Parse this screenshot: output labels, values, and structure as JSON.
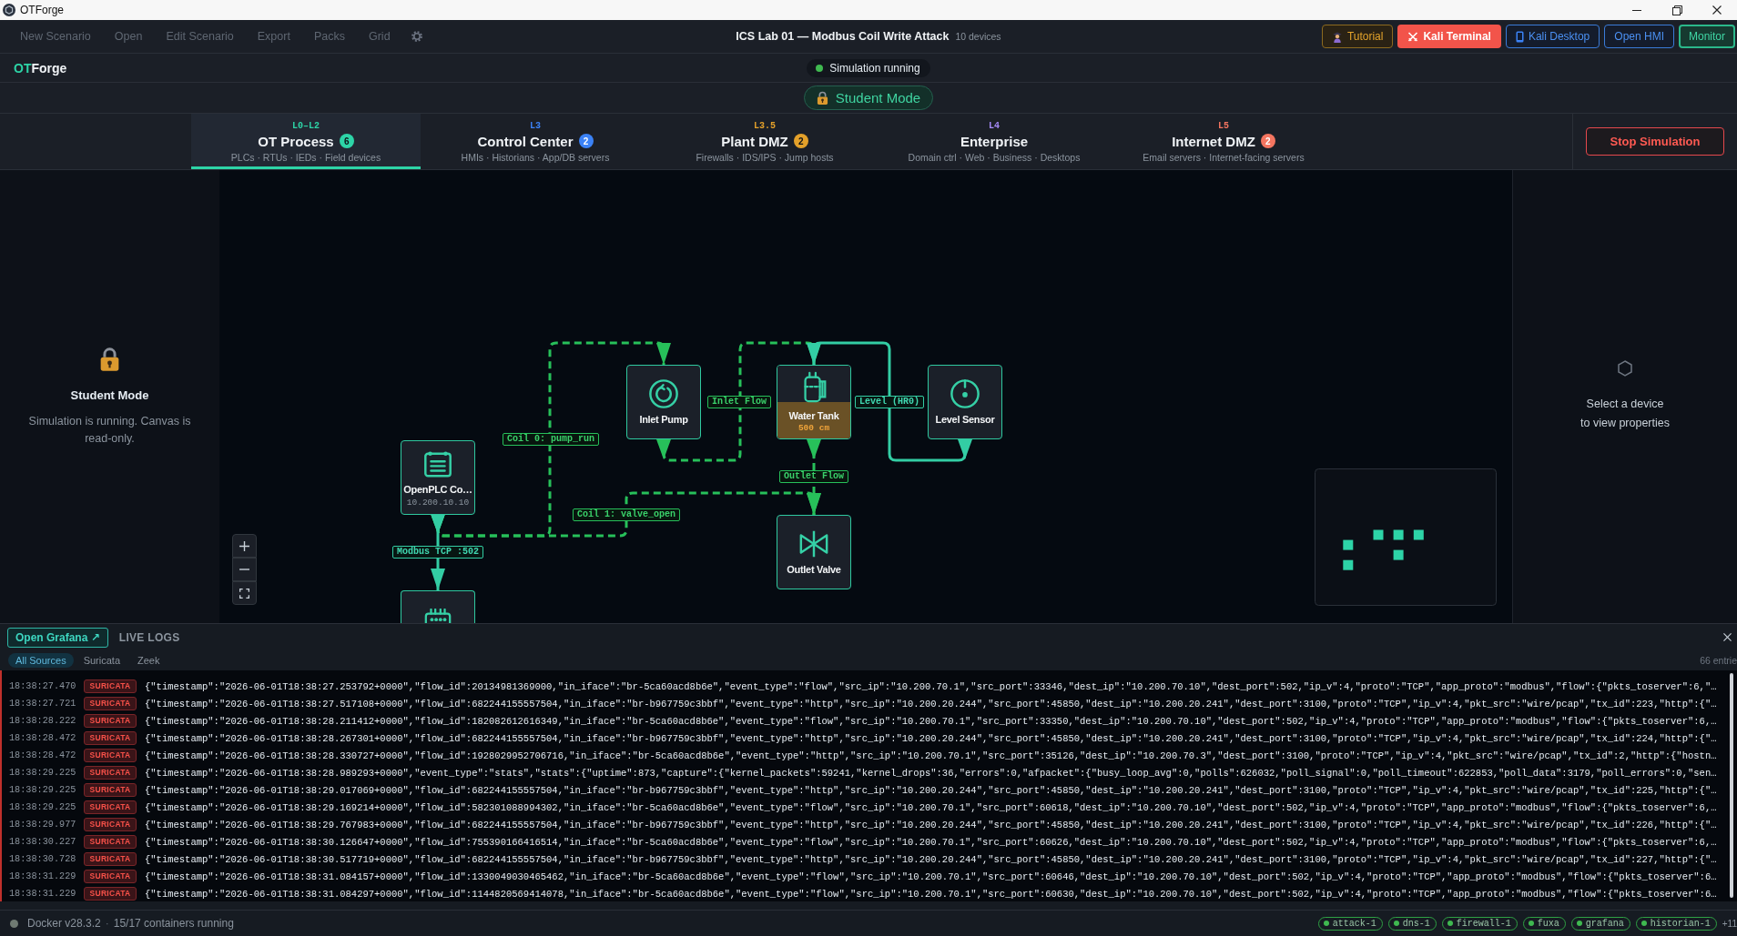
{
  "window": {
    "title": "OTForge"
  },
  "menu": [
    {
      "label": "New Scenario",
      "disabled": true
    },
    {
      "label": "Open",
      "disabled": true
    },
    {
      "label": "Edit Scenario",
      "disabled": true
    },
    {
      "label": "Export",
      "disabled": true
    },
    {
      "label": "Packs",
      "disabled": true
    },
    {
      "label": "Grid",
      "disabled": true
    }
  ],
  "scenario": {
    "title": "ICS Lab 01 — Modbus Coil Write Attack",
    "device_count": "10 devices"
  },
  "actions": [
    {
      "kind": "tutorial",
      "label": "Tutorial"
    },
    {
      "kind": "terminal",
      "label": "Kali Terminal"
    },
    {
      "kind": "desktop",
      "label": "Kali Desktop"
    },
    {
      "kind": "hmi",
      "label": "Open HMI"
    },
    {
      "kind": "monitor",
      "label": "Monitor"
    }
  ],
  "logo": {
    "accent": "OT",
    "rest": "Forge"
  },
  "simulation": {
    "status": "Simulation running",
    "running": true
  },
  "mode_badge": "Student Mode",
  "zones": [
    {
      "layer": "L0–L2",
      "name": "OT Process",
      "badge": "6",
      "subtitle": "PLCs · RTUs · IEDs · Field devices",
      "color": "#2dd4a7",
      "selected": true
    },
    {
      "layer": "L3",
      "name": "Control Center",
      "badge": "2",
      "subtitle": "HMIs · Historians · App/DB servers",
      "color": "#3b82f6",
      "selected": false
    },
    {
      "layer": "L3.5",
      "name": "Plant DMZ",
      "badge": "2",
      "subtitle": "Firewalls · IDS/IPS · Jump hosts",
      "color": "#e3a02a",
      "selected": false
    },
    {
      "layer": "L4",
      "name": "Enterprise",
      "subtitle": "Domain ctrl · Web · Business · Desktops",
      "color": "#a78bfa",
      "selected": false
    },
    {
      "layer": "L5",
      "name": "Internet DMZ",
      "badge": "2",
      "subtitle": "Email servers · Internet-facing servers",
      "color": "#f47560",
      "selected": false
    }
  ],
  "stop_button": "Stop Simulation",
  "notice": {
    "title": "Student Mode",
    "text": "Simulation is running. Canvas is read-only."
  },
  "nodes": [
    {
      "kind": "pump",
      "label": "Inlet Pump"
    },
    {
      "kind": "tank",
      "label": "Water Tank",
      "reading": "500 cm",
      "level": 0.5
    },
    {
      "kind": "sensor",
      "label": "Level Sensor"
    },
    {
      "kind": "plc",
      "label": "OpenPLC Co…",
      "address": "10.200.10.10"
    },
    {
      "kind": "valve",
      "label": "Outlet Valve"
    },
    {
      "kind": "rack"
    }
  ],
  "edges": [
    {
      "label": "Coil 0: pump_run",
      "animated": true
    },
    {
      "label": "Inlet Flow",
      "animated": true
    },
    {
      "label": "Level (HR0)",
      "animated": false
    },
    {
      "label": "Outlet Flow",
      "animated": true
    },
    {
      "label": "Coil 1: valve_open",
      "animated": true
    },
    {
      "label": "Modbus TCP :502",
      "animated": false
    }
  ],
  "properties": {
    "hint": "Select a device\nto view properties"
  },
  "logs": {
    "grafana_button": "Open Grafana ↗",
    "title": "LIVE LOGS",
    "sources": [
      {
        "label": "All Sources",
        "selected": true
      },
      {
        "label": "Suricata",
        "selected": false
      },
      {
        "label": "Zeek",
        "selected": false
      }
    ],
    "count": "66 entrie",
    "rows": [
      {
        "time": "18:38:27.470",
        "kind": "suricata",
        "source": "SURICATA",
        "message": "{\"timestamp\":\"2026-06-01T18:38:27.253792+0000\",\"flow_id\":20134981369000,\"in_iface\":\"br-5ca60acd8b6e\",\"event_type\":\"flow\",\"src_ip\":\"10.200.70.1\",\"src_port\":33346,\"dest_ip\":\"10.200.70.10\",\"dest_port\":502,\"ip_v\":4,\"proto\":\"TCP\",\"app_proto\":\"modbus\",\"flow\":{\"pkts_toserver\":6,\"…"
      },
      {
        "time": "18:38:27.721",
        "kind": "suricata",
        "source": "SURICATA",
        "message": "{\"timestamp\":\"2026-06-01T18:38:27.517108+0000\",\"flow_id\":682244155557504,\"in_iface\":\"br-b967759c3bbf\",\"event_type\":\"http\",\"src_ip\":\"10.200.20.244\",\"src_port\":45850,\"dest_ip\":\"10.200.20.241\",\"dest_port\":3100,\"proto\":\"TCP\",\"ip_v\":4,\"pkt_src\":\"wire/pcap\",\"tx_id\":223,\"http\":{\"…"
      },
      {
        "time": "18:38:28.222",
        "kind": "suricata",
        "source": "SURICATA",
        "message": "{\"timestamp\":\"2026-06-01T18:38:28.211412+0000\",\"flow_id\":182082612616349,\"in_iface\":\"br-5ca60acd8b6e\",\"event_type\":\"flow\",\"src_ip\":\"10.200.70.1\",\"src_port\":33350,\"dest_ip\":\"10.200.70.10\",\"dest_port\":502,\"ip_v\":4,\"proto\":\"TCP\",\"app_proto\":\"modbus\",\"flow\":{\"pkts_toserver\":6,…"
      },
      {
        "time": "18:38:28.472",
        "kind": "suricata",
        "source": "SURICATA",
        "message": "{\"timestamp\":\"2026-06-01T18:38:28.267301+0000\",\"flow_id\":682244155557504,\"in_iface\":\"br-b967759c3bbf\",\"event_type\":\"http\",\"src_ip\":\"10.200.20.244\",\"src_port\":45850,\"dest_ip\":\"10.200.20.241\",\"dest_port\":3100,\"proto\":\"TCP\",\"ip_v\":4,\"pkt_src\":\"wire/pcap\",\"tx_id\":224,\"http\":{\"…"
      },
      {
        "time": "18:38:28.472",
        "kind": "suricata",
        "source": "SURICATA",
        "message": "{\"timestamp\":\"2026-06-01T18:38:28.330727+0000\",\"flow_id\":1928029952706716,\"in_iface\":\"br-5ca60acd8b6e\",\"event_type\":\"http\",\"src_ip\":\"10.200.70.1\",\"src_port\":35126,\"dest_ip\":\"10.200.70.3\",\"dest_port\":3100,\"proto\":\"TCP\",\"ip_v\":4,\"pkt_src\":\"wire/pcap\",\"tx_id\":2,\"http\":{\"hostn…"
      },
      {
        "time": "18:38:29.225",
        "kind": "suricata",
        "source": "SURICATA",
        "message": "{\"timestamp\":\"2026-06-01T18:38:28.989293+0000\",\"event_type\":\"stats\",\"stats\":{\"uptime\":873,\"capture\":{\"kernel_packets\":59241,\"kernel_drops\":36,\"errors\":0,\"afpacket\":{\"busy_loop_avg\":0,\"polls\":626032,\"poll_signal\":0,\"poll_timeout\":622853,\"poll_data\":3179,\"poll_errors\":0,\"sen…"
      },
      {
        "time": "18:38:29.225",
        "kind": "suricata",
        "source": "SURICATA",
        "message": "{\"timestamp\":\"2026-06-01T18:38:29.017069+0000\",\"flow_id\":682244155557504,\"in_iface\":\"br-b967759c3bbf\",\"event_type\":\"http\",\"src_ip\":\"10.200.20.244\",\"src_port\":45850,\"dest_ip\":\"10.200.20.241\",\"dest_port\":3100,\"proto\":\"TCP\",\"ip_v\":4,\"pkt_src\":\"wire/pcap\",\"tx_id\":225,\"http\":{\"…"
      },
      {
        "time": "18:38:29.225",
        "kind": "suricata",
        "source": "SURICATA",
        "message": "{\"timestamp\":\"2026-06-01T18:38:29.169214+0000\",\"flow_id\":582301088994302,\"in_iface\":\"br-5ca60acd8b6e\",\"event_type\":\"flow\",\"src_ip\":\"10.200.70.1\",\"src_port\":60618,\"dest_ip\":\"10.200.70.10\",\"dest_port\":502,\"ip_v\":4,\"proto\":\"TCP\",\"app_proto\":\"modbus\",\"flow\":{\"pkts_toserver\":6,…"
      },
      {
        "time": "18:38:29.977",
        "kind": "suricata",
        "source": "SURICATA",
        "message": "{\"timestamp\":\"2026-06-01T18:38:29.767983+0000\",\"flow_id\":682244155557504,\"in_iface\":\"br-b967759c3bbf\",\"event_type\":\"http\",\"src_ip\":\"10.200.20.244\",\"src_port\":45850,\"dest_ip\":\"10.200.20.241\",\"dest_port\":3100,\"proto\":\"TCP\",\"ip_v\":4,\"pkt_src\":\"wire/pcap\",\"tx_id\":226,\"http\":{\"…"
      },
      {
        "time": "18:38:30.227",
        "kind": "suricata",
        "source": "SURICATA",
        "message": "{\"timestamp\":\"2026-06-01T18:38:30.126647+0000\",\"flow_id\":755390166416514,\"in_iface\":\"br-5ca60acd8b6e\",\"event_type\":\"flow\",\"src_ip\":\"10.200.70.1\",\"src_port\":60626,\"dest_ip\":\"10.200.70.10\",\"dest_port\":502,\"ip_v\":4,\"proto\":\"TCP\",\"app_proto\":\"modbus\",\"flow\":{\"pkts_toserver\":6,…"
      },
      {
        "time": "18:38:30.728",
        "kind": "suricata",
        "source": "SURICATA",
        "message": "{\"timestamp\":\"2026-06-01T18:38:30.517719+0000\",\"flow_id\":682244155557504,\"in_iface\":\"br-b967759c3bbf\",\"event_type\":\"http\",\"src_ip\":\"10.200.20.244\",\"src_port\":45850,\"dest_ip\":\"10.200.20.241\",\"dest_port\":3100,\"proto\":\"TCP\",\"ip_v\":4,\"pkt_src\":\"wire/pcap\",\"tx_id\":227,\"http\":{\"…"
      },
      {
        "time": "18:38:31.229",
        "kind": "suricata",
        "source": "SURICATA",
        "message": "{\"timestamp\":\"2026-06-01T18:38:31.084157+0000\",\"flow_id\":1330049030465462,\"in_iface\":\"br-5ca60acd8b6e\",\"event_type\":\"flow\",\"src_ip\":\"10.200.70.1\",\"src_port\":60646,\"dest_ip\":\"10.200.70.10\",\"dest_port\":502,\"ip_v\":4,\"proto\":\"TCP\",\"app_proto\":\"modbus\",\"flow\":{\"pkts_toserver\":6…"
      },
      {
        "time": "18:38:31.229",
        "kind": "suricata",
        "source": "SURICATA",
        "message": "{\"timestamp\":\"2026-06-01T18:38:31.084297+0000\",\"flow_id\":1144820569414078,\"in_iface\":\"br-5ca60acd8b6e\",\"event_type\":\"flow\",\"src_ip\":\"10.200.70.1\",\"src_port\":60630,\"dest_ip\":\"10.200.70.10\",\"dest_port\":502,\"ip_v\":4,\"proto\":\"TCP\",\"app_proto\":\"modbus\",\"flow\":{\"pkts_toserver\":6…"
      }
    ]
  },
  "status_bar": {
    "docker": "Docker v28.3.2",
    "separator": "·",
    "containers_running": "15/17 containers running",
    "containers": [
      "attack-1",
      "dns-1",
      "firewall-1",
      "fuxa",
      "grafana",
      "historian-1"
    ],
    "more": "+11"
  }
}
